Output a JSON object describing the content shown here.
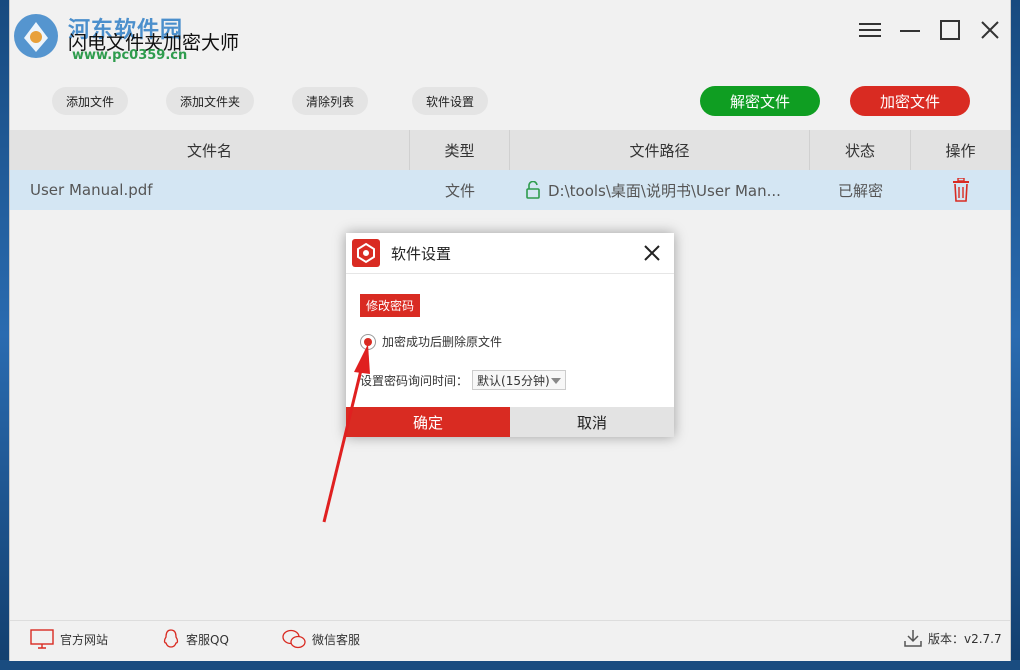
{
  "window": {
    "title": "闪电文件夹加密大师",
    "watermark": "河东软件园",
    "watermark_url": "www.pc0359.cn"
  },
  "toolbar": {
    "add_file": "添加文件",
    "add_folder": "添加文件夹",
    "clear_list": "清除列表",
    "settings": "软件设置",
    "decrypt": "解密文件",
    "encrypt": "加密文件"
  },
  "table": {
    "headers": [
      "文件名",
      "类型",
      "文件路径",
      "状态",
      "操作"
    ],
    "rows": [
      {
        "name": "User Manual.pdf",
        "type": "文件",
        "path": "D:\\tools\\桌面\\说明书\\User Man...",
        "status": "已解密"
      }
    ]
  },
  "dialog": {
    "title": "软件设置",
    "change_password": "修改密码",
    "delete_original": "加密成功后删除原文件",
    "interval_label": "设置密码询问时间：",
    "interval_value": "默认(15分钟)",
    "ok": "确定",
    "cancel": "取消"
  },
  "footer": {
    "website": "官方网站",
    "qq": "客服QQ",
    "wechat": "微信客服",
    "version": "版本：v2.7.7"
  },
  "colors": {
    "accent_red": "#d92b22",
    "accent_green": "#0f9e22",
    "row_highlight": "#d4e6f3"
  }
}
